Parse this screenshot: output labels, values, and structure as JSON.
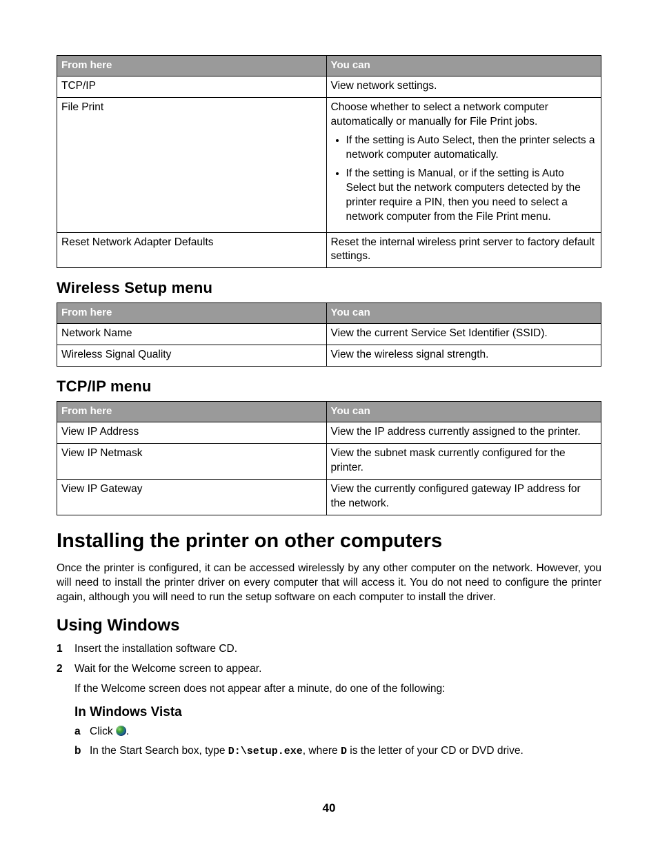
{
  "table1": {
    "headers": [
      "From here",
      "You can"
    ],
    "rows": [
      {
        "c0": "TCP/IP",
        "c1": "View network settings."
      },
      {
        "c0": "File Print",
        "c1_intro": "Choose whether to select a network computer automatically or manually for File Print jobs.",
        "c1_bullets": [
          "If the setting is Auto Select, then the printer selects a network computer automatically.",
          "If the setting is Manual, or if the setting is Auto Select but the network computers detected by the printer require a PIN, then you need to select a network computer from the File Print menu."
        ]
      },
      {
        "c0": "Reset Network Adapter Defaults",
        "c1": "Reset the internal wireless print server to factory default settings."
      }
    ]
  },
  "sec_wireless": "Wireless Setup menu",
  "table2": {
    "headers": [
      "From here",
      "You can"
    ],
    "rows": [
      {
        "c0": "Network Name",
        "c1": "View the current Service Set Identifier (SSID)."
      },
      {
        "c0": "Wireless Signal Quality",
        "c1": "View the wireless signal strength."
      }
    ]
  },
  "sec_tcpip": "TCP/IP menu",
  "table3": {
    "headers": [
      "From here",
      "You can"
    ],
    "rows": [
      {
        "c0": "View IP Address",
        "c1": "View the IP address currently assigned to the printer."
      },
      {
        "c0": "View IP Netmask",
        "c1": "View the subnet mask currently configured for the printer."
      },
      {
        "c0": "View IP Gateway",
        "c1": "View the currently configured gateway IP address for the network."
      }
    ]
  },
  "h1": "Installing the printer on other computers",
  "intro_para": "Once the printer is configured, it can be accessed wirelessly by any other computer on the network. However, you will need to install the printer driver on every computer that will access it. You do not need to configure the printer again, although you will need to run the setup software on each computer to install the driver.",
  "sec_windows": "Using Windows",
  "steps": {
    "s1": "Insert the installation software CD.",
    "s2": "Wait for the Welcome screen to appear.",
    "s2_note": "If the Welcome screen does not appear after a minute, do one of the following:"
  },
  "sec_vista": "In Windows Vista",
  "vista": {
    "a_pre": "Click ",
    "a_post": ".",
    "b_pre": "In the Start Search box, type ",
    "b_code1": "D:\\setup.exe",
    "b_mid": ", where ",
    "b_code2": "D",
    "b_post": " is the letter of your CD or DVD drive."
  },
  "pagenum": "40"
}
